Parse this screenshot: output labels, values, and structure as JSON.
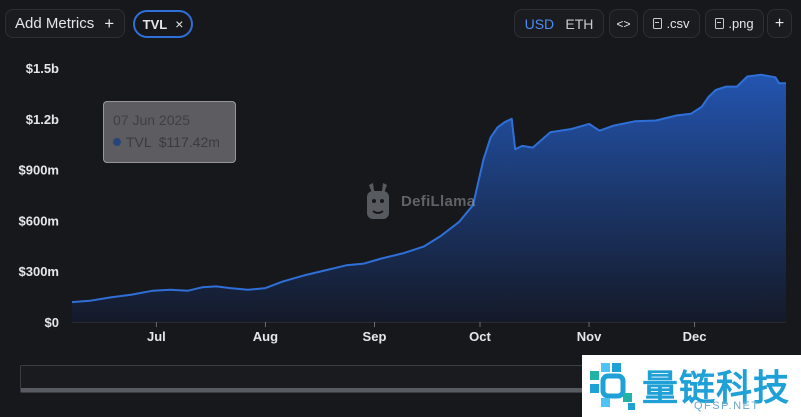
{
  "toolbar": {
    "add_metrics_label": "Add Metrics",
    "add_metrics_plus": "+",
    "metric_chip_label": "TVL",
    "metric_chip_close": "×",
    "unit_usd": "USD",
    "unit_eth": "ETH",
    "unit_selected": "USD",
    "embed_label": "<>",
    "csv_label": ".csv",
    "png_label": ".png",
    "add_label": "+"
  },
  "colors": {
    "accent": "#4c8bf5",
    "line": "#2f6fd8",
    "area_top": "#2458b8",
    "area_bottom": "#141a2a",
    "background": "#17181b"
  },
  "tooltip": {
    "date": "07 Jun 2025",
    "series_name": "TVL",
    "value": "$117.42m"
  },
  "watermark": {
    "text": "DefiLlama"
  },
  "stamp": {
    "text_cn": "量链科技",
    "text_en": "QFSP.NET"
  },
  "chart_data": {
    "type": "area",
    "title": "",
    "xlabel": "",
    "ylabel": "",
    "x_range": [
      "2025-06-07",
      "2025-12-27"
    ],
    "ylim": [
      0,
      1500000000
    ],
    "y_ticks": [
      0,
      300000000,
      600000000,
      900000000,
      1200000000,
      1500000000
    ],
    "y_tick_labels": [
      "$0",
      "$300m",
      "$600m",
      "$900m",
      "$1.2b",
      "$1.5b"
    ],
    "x_ticks": [
      "2025-07-01",
      "2025-08-01",
      "2025-09-01",
      "2025-10-01",
      "2025-11-01",
      "2025-12-01"
    ],
    "x_tick_labels": [
      "Jul",
      "Aug",
      "Sep",
      "Oct",
      "Nov",
      "Dec"
    ],
    "grid": false,
    "series": [
      {
        "name": "TVL",
        "x": [
          "2025-06-07",
          "2025-06-12",
          "2025-06-18",
          "2025-06-24",
          "2025-06-30",
          "2025-07-05",
          "2025-07-10",
          "2025-07-14",
          "2025-07-18",
          "2025-07-22",
          "2025-07-27",
          "2025-08-01",
          "2025-08-06",
          "2025-08-12",
          "2025-08-18",
          "2025-08-24",
          "2025-08-29",
          "2025-09-03",
          "2025-09-09",
          "2025-09-15",
          "2025-09-20",
          "2025-09-25",
          "2025-09-29",
          "2025-10-02",
          "2025-10-04",
          "2025-10-06",
          "2025-10-08",
          "2025-10-10",
          "2025-10-11",
          "2025-10-13",
          "2025-10-16",
          "2025-10-21",
          "2025-10-27",
          "2025-11-01",
          "2025-11-04",
          "2025-11-08",
          "2025-11-14",
          "2025-11-20",
          "2025-11-26",
          "2025-11-30",
          "2025-12-03",
          "2025-12-05",
          "2025-12-07",
          "2025-12-10",
          "2025-12-13",
          "2025-12-16",
          "2025-12-20",
          "2025-12-24",
          "2025-12-25",
          "2025-12-27"
        ],
        "y": [
          117420000,
          125000000,
          145000000,
          162000000,
          185000000,
          190000000,
          185000000,
          205000000,
          210000000,
          200000000,
          190000000,
          200000000,
          240000000,
          275000000,
          305000000,
          335000000,
          345000000,
          375000000,
          405000000,
          445000000,
          510000000,
          590000000,
          690000000,
          960000000,
          1090000000,
          1150000000,
          1180000000,
          1200000000,
          1020000000,
          1040000000,
          1030000000,
          1120000000,
          1140000000,
          1170000000,
          1130000000,
          1160000000,
          1185000000,
          1190000000,
          1220000000,
          1230000000,
          1270000000,
          1330000000,
          1370000000,
          1390000000,
          1390000000,
          1450000000,
          1460000000,
          1445000000,
          1410000000,
          1410000000
        ]
      }
    ]
  }
}
